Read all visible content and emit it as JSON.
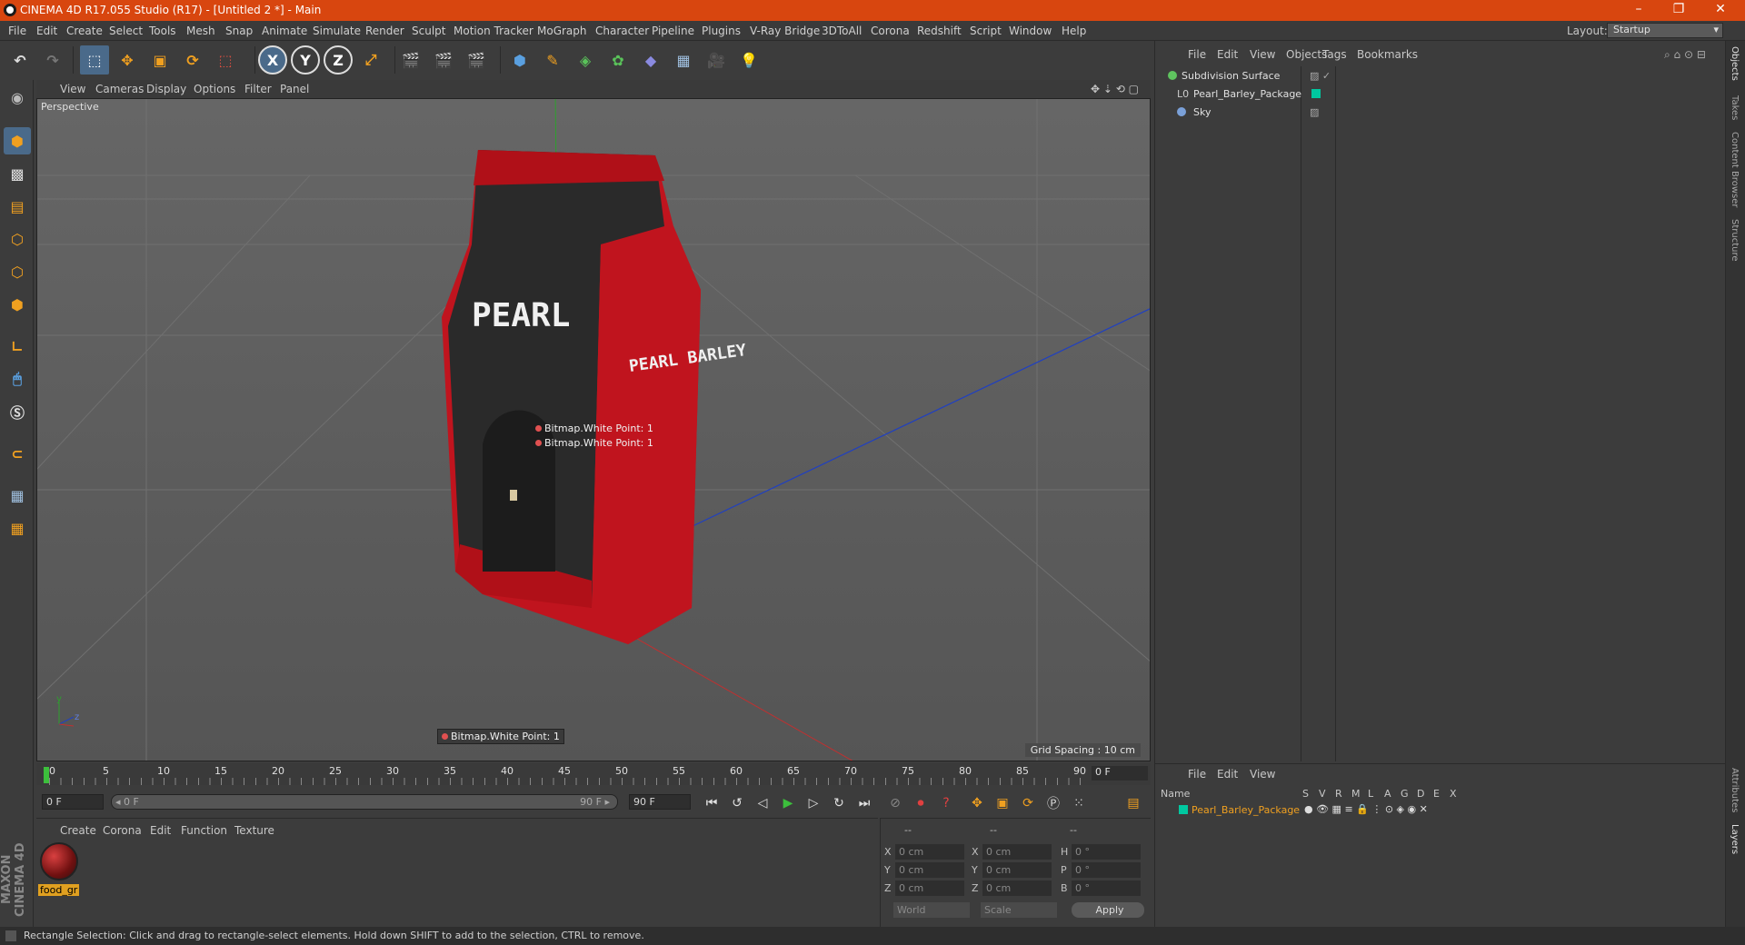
{
  "window": {
    "title": "CINEMA 4D R17.055 Studio (R17) - [Untitled 2 *] - Main",
    "minimize": "–",
    "restore": "❐",
    "close": "✕"
  },
  "menubar": {
    "items": [
      "File",
      "Edit",
      "Create",
      "Select",
      "Tools",
      "Mesh",
      "Snap",
      "Animate",
      "Simulate",
      "Render",
      "Sculpt",
      "Motion Tracker",
      "MoGraph",
      "Character",
      "Pipeline",
      "Plugins",
      "V-Ray Bridge",
      "3DToAll",
      "Corona",
      "Redshift",
      "Script",
      "Window",
      "Help"
    ],
    "layout_label": "Layout:",
    "layout_value": "Startup"
  },
  "toolbar": {
    "axis_x": "X",
    "axis_y": "Y",
    "axis_z": "Z"
  },
  "viewport": {
    "menu": [
      "View",
      "Cameras",
      "Display",
      "Options",
      "Filter",
      "Panel"
    ],
    "label": "Perspective",
    "grid_spacing": "Grid Spacing : 10 cm",
    "package_front_text": "PEARL",
    "package_side_text": "PEARL BARLEY",
    "tag1": "Bitmap.White Point:  1",
    "tag2": "Bitmap.White Point:  1",
    "tag3": "Bitmap.White Point:  1",
    "axis_y_label": "y",
    "axis_z_label": "z"
  },
  "timeline": {
    "ticks": [
      "0",
      "5",
      "10",
      "15",
      "20",
      "25",
      "30",
      "35",
      "40",
      "45",
      "50",
      "55",
      "60",
      "65",
      "70",
      "75",
      "80",
      "85",
      "90"
    ],
    "current_frame": "0 F"
  },
  "transport": {
    "start_field": "0 F",
    "range_left": "◂ 0 F",
    "range_right": "90 F ▸",
    "end_field": "90 F"
  },
  "material_panel": {
    "menu": [
      "Create",
      "Corona",
      "Edit",
      "Function",
      "Texture"
    ],
    "material_name": "food_gr"
  },
  "coordinates": {
    "header_left": "--",
    "header_mid": "--",
    "header_right": "--",
    "rows": [
      {
        "l1": "X",
        "v1": "0 cm",
        "l2": "X",
        "v2": "0 cm",
        "l3": "H",
        "v3": "0 °"
      },
      {
        "l1": "Y",
        "v1": "0 cm",
        "l2": "Y",
        "v2": "0 cm",
        "l3": "P",
        "v3": "0 °"
      },
      {
        "l1": "Z",
        "v1": "0 cm",
        "l2": "Z",
        "v2": "0 cm",
        "l3": "B",
        "v3": "0 °"
      }
    ],
    "space": "World",
    "mode": "Scale",
    "apply": "Apply"
  },
  "object_manager": {
    "menu": [
      "File",
      "Edit",
      "View",
      "Objects",
      "Tags",
      "Bookmarks"
    ],
    "objects": [
      {
        "name": "Subdivision Surface",
        "color": "#5fc35f"
      },
      {
        "name": "Pearl_Barley_Package",
        "color": "#00c8a0"
      },
      {
        "name": "Sky",
        "color": "#7aa0d8"
      }
    ]
  },
  "layer_manager": {
    "menu": [
      "File",
      "Edit",
      "View"
    ],
    "headers": [
      "Name",
      "S",
      "V",
      "R",
      "M",
      "L",
      "A",
      "G",
      "D",
      "E",
      "X"
    ],
    "layer_name": "Pearl_Barley_Package",
    "layer_color": "#00c8a0"
  },
  "side_tabs": [
    "Objects",
    "Takes",
    "Content Browser",
    "Structure"
  ],
  "side_tabs_lower": [
    "Attributes",
    "Layers"
  ],
  "brand": "MAXON CINEMA 4D",
  "status": "Rectangle Selection: Click and drag to rectangle-select elements. Hold down SHIFT to add to the selection, CTRL to remove.",
  "colors": {
    "title_accent": "#d8460f",
    "package_red": "#c0141e",
    "package_dark": "#2a2a2a"
  }
}
